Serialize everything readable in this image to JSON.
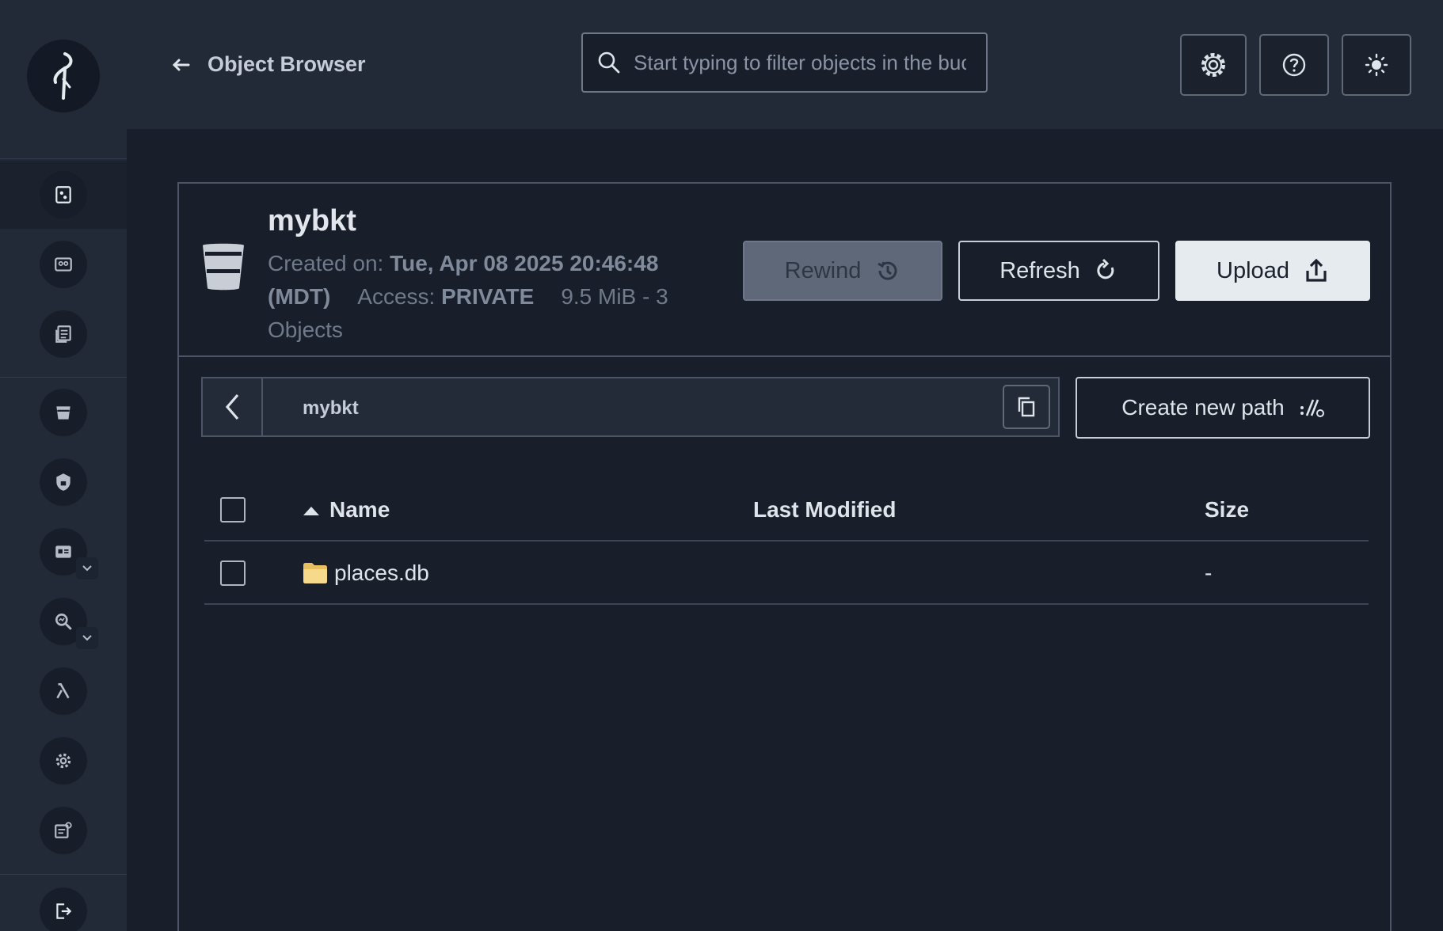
{
  "header": {
    "title": "Object Browser",
    "search_placeholder": "Start typing to filter objects in the bucket"
  },
  "bucket": {
    "name": "mybkt",
    "created_label": "Created on:",
    "created_value": "Tue, Apr 08 2025 20:46:48 (MDT)",
    "access_label": "Access:",
    "access_value": "PRIVATE",
    "size": "9.5 MiB - 3 Objects",
    "rewind_label": "Rewind",
    "refresh_label": "Refresh",
    "upload_label": "Upload"
  },
  "path": {
    "current": "mybkt",
    "create_label": "Create new path"
  },
  "table": {
    "columns": {
      "name": "Name",
      "modified": "Last Modified",
      "size": "Size"
    },
    "rows": [
      {
        "name": "places.db",
        "modified": "",
        "size": "-"
      }
    ]
  },
  "colors": {
    "background": "#181e2a",
    "sidebar": "#222a38",
    "folder": "#f0cf7a"
  }
}
